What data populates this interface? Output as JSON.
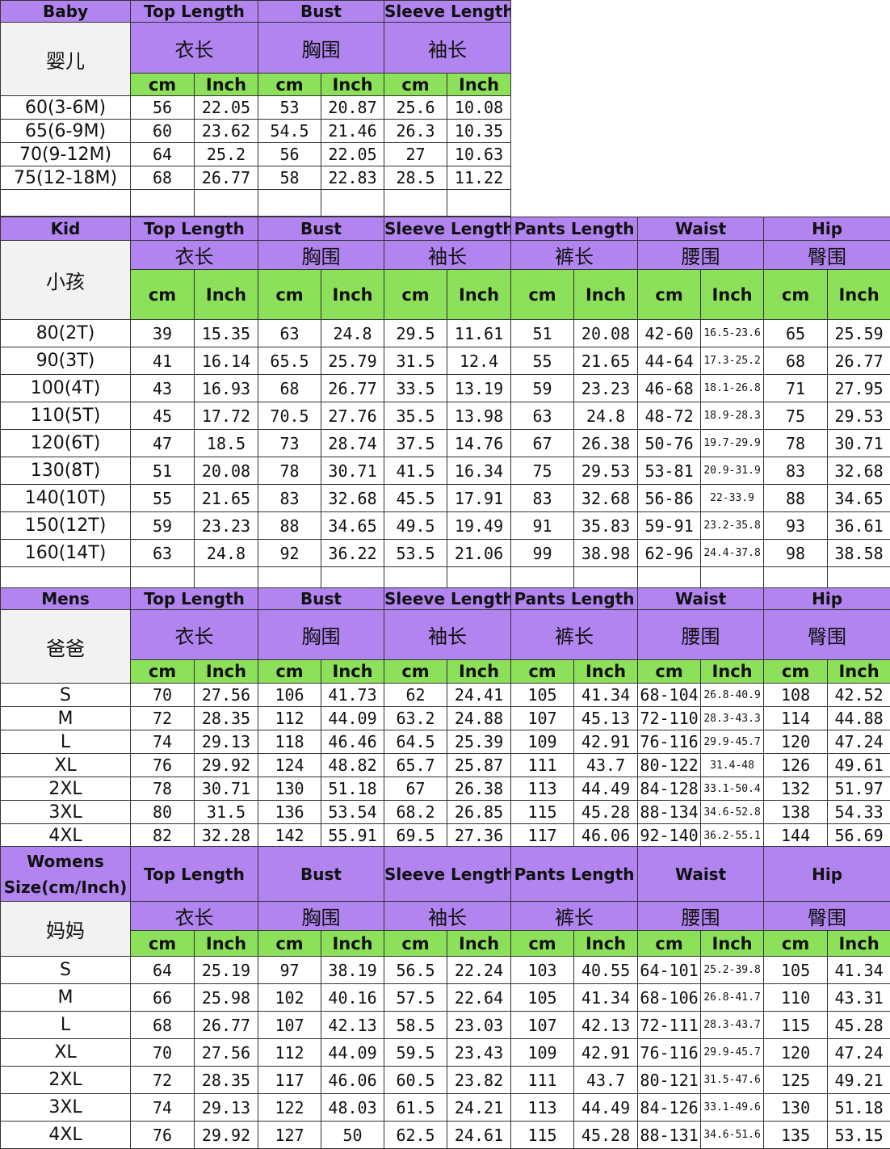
{
  "headers": {
    "top_length": "Top Length",
    "bust": "Bust",
    "sleeve_length": "Sleeve Length",
    "pants_length": "Pants Length",
    "waist": "Waist",
    "hip": "Hip",
    "cn_top": "衣长",
    "cn_bust": "胸围",
    "cn_sleeve": "袖长",
    "cn_pants": "裤长",
    "cn_waist": "腰围",
    "cn_hip": "臀围",
    "cm": "cm",
    "inch": "Inch"
  },
  "baby": {
    "label": "Baby",
    "cn_label": "婴儿",
    "rows": [
      [
        "60(3-6M)",
        "56",
        "22.05",
        "53",
        "20.87",
        "25.6",
        "10.08"
      ],
      [
        "65(6-9M)",
        "60",
        "23.62",
        "54.5",
        "21.46",
        "26.3",
        "10.35"
      ],
      [
        "70(9-12M)",
        "64",
        "25.2",
        "56",
        "22.05",
        "27",
        "10.63"
      ],
      [
        "75(12-18M)",
        "68",
        "26.77",
        "58",
        "22.83",
        "28.5",
        "11.22"
      ]
    ]
  },
  "kid": {
    "label": "Kid",
    "cn_label": "小孩",
    "rows": [
      [
        "80(2T)",
        "39",
        "15.35",
        "63",
        "24.8",
        "29.5",
        "11.61",
        "51",
        "20.08",
        "42-60",
        "16.5-23.6",
        "65",
        "25.59"
      ],
      [
        "90(3T)",
        "41",
        "16.14",
        "65.5",
        "25.79",
        "31.5",
        "12.4",
        "55",
        "21.65",
        "44-64",
        "17.3-25.2",
        "68",
        "26.77"
      ],
      [
        "100(4T)",
        "43",
        "16.93",
        "68",
        "26.77",
        "33.5",
        "13.19",
        "59",
        "23.23",
        "46-68",
        "18.1-26.8",
        "71",
        "27.95"
      ],
      [
        "110(5T)",
        "45",
        "17.72",
        "70.5",
        "27.76",
        "35.5",
        "13.98",
        "63",
        "24.8",
        "48-72",
        "18.9-28.3",
        "75",
        "29.53"
      ],
      [
        "120(6T)",
        "47",
        "18.5",
        "73",
        "28.74",
        "37.5",
        "14.76",
        "67",
        "26.38",
        "50-76",
        "19.7-29.9",
        "78",
        "30.71"
      ],
      [
        "130(8T)",
        "51",
        "20.08",
        "78",
        "30.71",
        "41.5",
        "16.34",
        "75",
        "29.53",
        "53-81",
        "20.9-31.9",
        "83",
        "32.68"
      ],
      [
        "140(10T)",
        "55",
        "21.65",
        "83",
        "32.68",
        "45.5",
        "17.91",
        "83",
        "32.68",
        "56-86",
        "22-33.9",
        "88",
        "34.65"
      ],
      [
        "150(12T)",
        "59",
        "23.23",
        "88",
        "34.65",
        "49.5",
        "19.49",
        "91",
        "35.83",
        "59-91",
        "23.2-35.8",
        "93",
        "36.61"
      ],
      [
        "160(14T)",
        "63",
        "24.8",
        "92",
        "36.22",
        "53.5",
        "21.06",
        "99",
        "38.98",
        "62-96",
        "24.4-37.8",
        "98",
        "38.58"
      ]
    ]
  },
  "mens": {
    "label": "Mens",
    "cn_label": "爸爸",
    "rows": [
      [
        "S",
        "70",
        "27.56",
        "106",
        "41.73",
        "62",
        "24.41",
        "105",
        "41.34",
        "68-104",
        "26.8-40.9",
        "108",
        "42.52"
      ],
      [
        "M",
        "72",
        "28.35",
        "112",
        "44.09",
        "63.2",
        "24.88",
        "107",
        "45.13",
        "72-110",
        "28.3-43.3",
        "114",
        "44.88"
      ],
      [
        "L",
        "74",
        "29.13",
        "118",
        "46.46",
        "64.5",
        "25.39",
        "109",
        "42.91",
        "76-116",
        "29.9-45.7",
        "120",
        "47.24"
      ],
      [
        "XL",
        "76",
        "29.92",
        "124",
        "48.82",
        "65.7",
        "25.87",
        "111",
        "43.7",
        "80-122",
        "31.4-48",
        "126",
        "49.61"
      ],
      [
        "2XL",
        "78",
        "30.71",
        "130",
        "51.18",
        "67",
        "26.38",
        "113",
        "44.49",
        "84-128",
        "33.1-50.4",
        "132",
        "51.97"
      ],
      [
        "3XL",
        "80",
        "31.5",
        "136",
        "53.54",
        "68.2",
        "26.85",
        "115",
        "45.28",
        "88-134",
        "34.6-52.8",
        "138",
        "54.33"
      ],
      [
        "4XL",
        "82",
        "32.28",
        "142",
        "55.91",
        "69.5",
        "27.36",
        "117",
        "46.06",
        "92-140",
        "36.2-55.1",
        "144",
        "56.69"
      ]
    ]
  },
  "womens": {
    "label_line1": "Womens",
    "label_line2": "Size(cm/Inch)",
    "cn_label": "妈妈",
    "rows": [
      [
        "S",
        "64",
        "25.19",
        "97",
        "38.19",
        "56.5",
        "22.24",
        "103",
        "40.55",
        "64-101",
        "25.2-39.8",
        "105",
        "41.34"
      ],
      [
        "M",
        "66",
        "25.98",
        "102",
        "40.16",
        "57.5",
        "22.64",
        "105",
        "41.34",
        "68-106",
        "26.8-41.7",
        "110",
        "43.31"
      ],
      [
        "L",
        "68",
        "26.77",
        "107",
        "42.13",
        "58.5",
        "23.03",
        "107",
        "42.13",
        "72-111",
        "28.3-43.7",
        "115",
        "45.28"
      ],
      [
        "XL",
        "70",
        "27.56",
        "112",
        "44.09",
        "59.5",
        "23.43",
        "109",
        "42.91",
        "76-116",
        "29.9-45.7",
        "120",
        "47.24"
      ],
      [
        "2XL",
        "72",
        "28.35",
        "117",
        "46.06",
        "60.5",
        "23.82",
        "111",
        "43.7",
        "80-121",
        "31.5-47.6",
        "125",
        "49.21"
      ],
      [
        "3XL",
        "74",
        "29.13",
        "122",
        "48.03",
        "61.5",
        "24.21",
        "113",
        "44.49",
        "84-126",
        "33.1-49.6",
        "130",
        "51.18"
      ],
      [
        "4XL",
        "76",
        "29.92",
        "127",
        "50",
        "62.5",
        "24.61",
        "115",
        "45.28",
        "88-131",
        "34.6-51.6",
        "135",
        "53.15"
      ]
    ]
  }
}
